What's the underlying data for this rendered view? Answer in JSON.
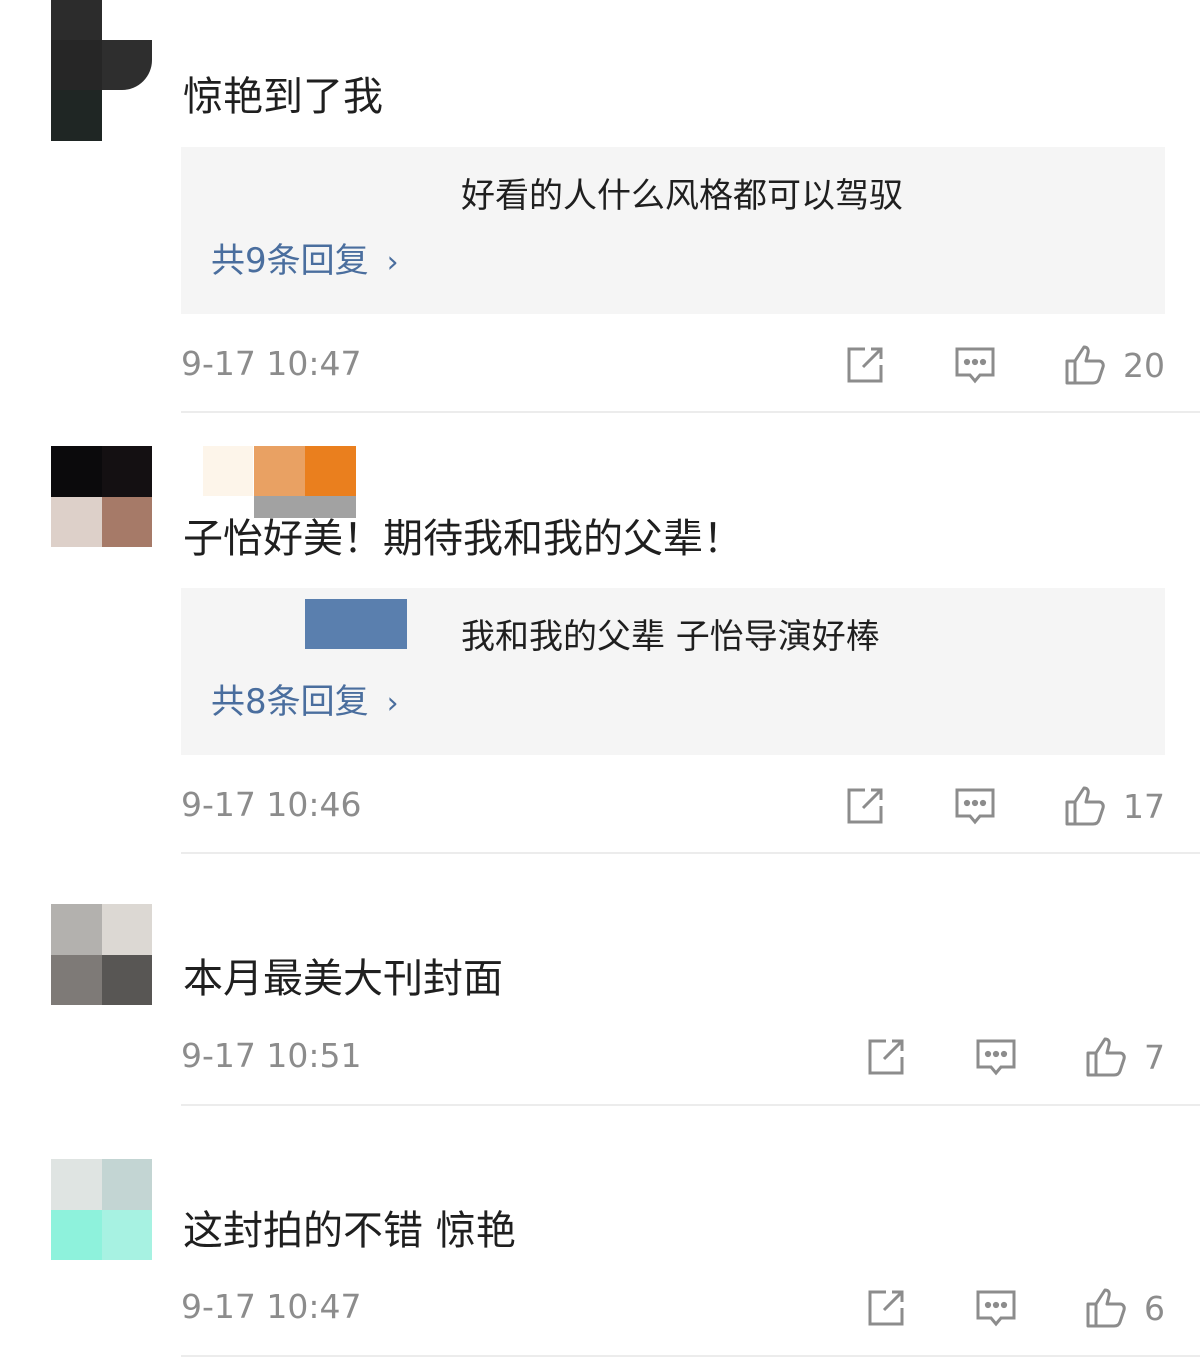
{
  "comments": [
    {
      "text": "惊艳到了我",
      "reply_preview": "好看的人什么风格都可以驾驭",
      "reply_count_label": "共9条回复",
      "time": "9-17 10:47",
      "likes": "20"
    },
    {
      "text": "子怡好美！期待我和我的父辈！",
      "reply_preview": "我和我的父辈 子怡导演好棒",
      "reply_count_label": "共8条回复",
      "time": "9-17 10:46",
      "likes": "17"
    },
    {
      "text": "本月最美大刊封面",
      "time": "9-17 10:51",
      "likes": "7"
    },
    {
      "text": "这封拍的不错 惊艳",
      "time": "9-17 10:47",
      "likes": "6"
    }
  ],
  "icons": {
    "share": "share-icon",
    "comment": "comment-icon",
    "like": "thumbs-up-icon",
    "chevron": "chevron-right-icon"
  },
  "colors": {
    "link": "#4a6e9e",
    "meta_text": "#8c8c8c",
    "reply_bg": "#f5f5f5",
    "divider": "#ececec"
  }
}
